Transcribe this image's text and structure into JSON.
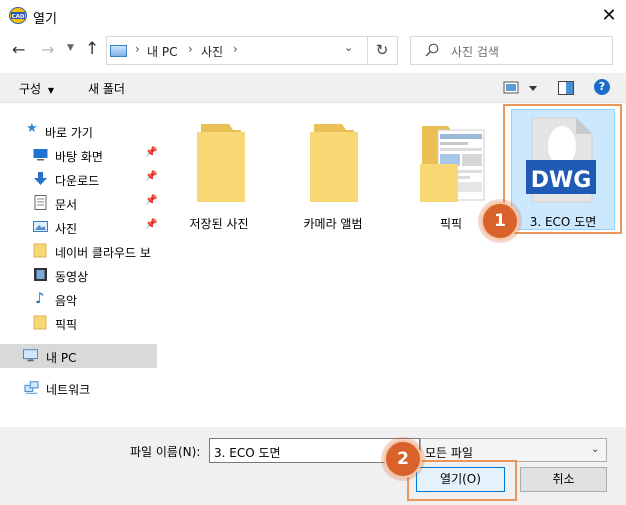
{
  "window": {
    "title": "열기"
  },
  "address": {
    "crumbs": [
      "내 PC",
      "사진"
    ],
    "search_placeholder": "사진 검색"
  },
  "toolbar": {
    "organize": "구성",
    "new_folder": "새 폴더",
    "help": "?"
  },
  "nav": {
    "quick_access": "바로 가기",
    "items": [
      {
        "label": "바탕 화면",
        "icon": "desktop-icon",
        "pinned": true
      },
      {
        "label": "다운로드",
        "icon": "download-arrow-icon",
        "pinned": true
      },
      {
        "label": "문서",
        "icon": "document-icon",
        "pinned": true
      },
      {
        "label": "사진",
        "icon": "pictures-icon",
        "pinned": true
      },
      {
        "label": "네이버 클라우드 보",
        "icon": "folder-icon",
        "pinned": false
      },
      {
        "label": "동영상",
        "icon": "video-icon",
        "pinned": false
      },
      {
        "label": "음악",
        "icon": "music-note-icon",
        "pinned": false
      },
      {
        "label": "픽픽",
        "icon": "folder-icon",
        "pinned": false
      }
    ],
    "this_pc": "내 PC",
    "network": "네트워크"
  },
  "content": {
    "items": [
      {
        "label": "저장된 사진",
        "type": "folder"
      },
      {
        "label": "카메라 앨범",
        "type": "folder"
      },
      {
        "label": "픽픽",
        "type": "folder-with-thumbnails"
      },
      {
        "label": "3. ECO 도면",
        "type": "dwg-file",
        "badge": "DWG",
        "selected": true
      }
    ]
  },
  "footer": {
    "filename_label": "파일 이름(N):",
    "filename_value": "3. ECO 도면",
    "filetype_value": "모든 파일",
    "open_label": "열기(O)",
    "cancel_label": "취소"
  },
  "annotations": {
    "step1": "1",
    "step2": "2"
  },
  "colors": {
    "accent": "#0078d7",
    "selection": "#cce8ff",
    "annotation": "#d9612a",
    "folder": "#f8d775"
  }
}
